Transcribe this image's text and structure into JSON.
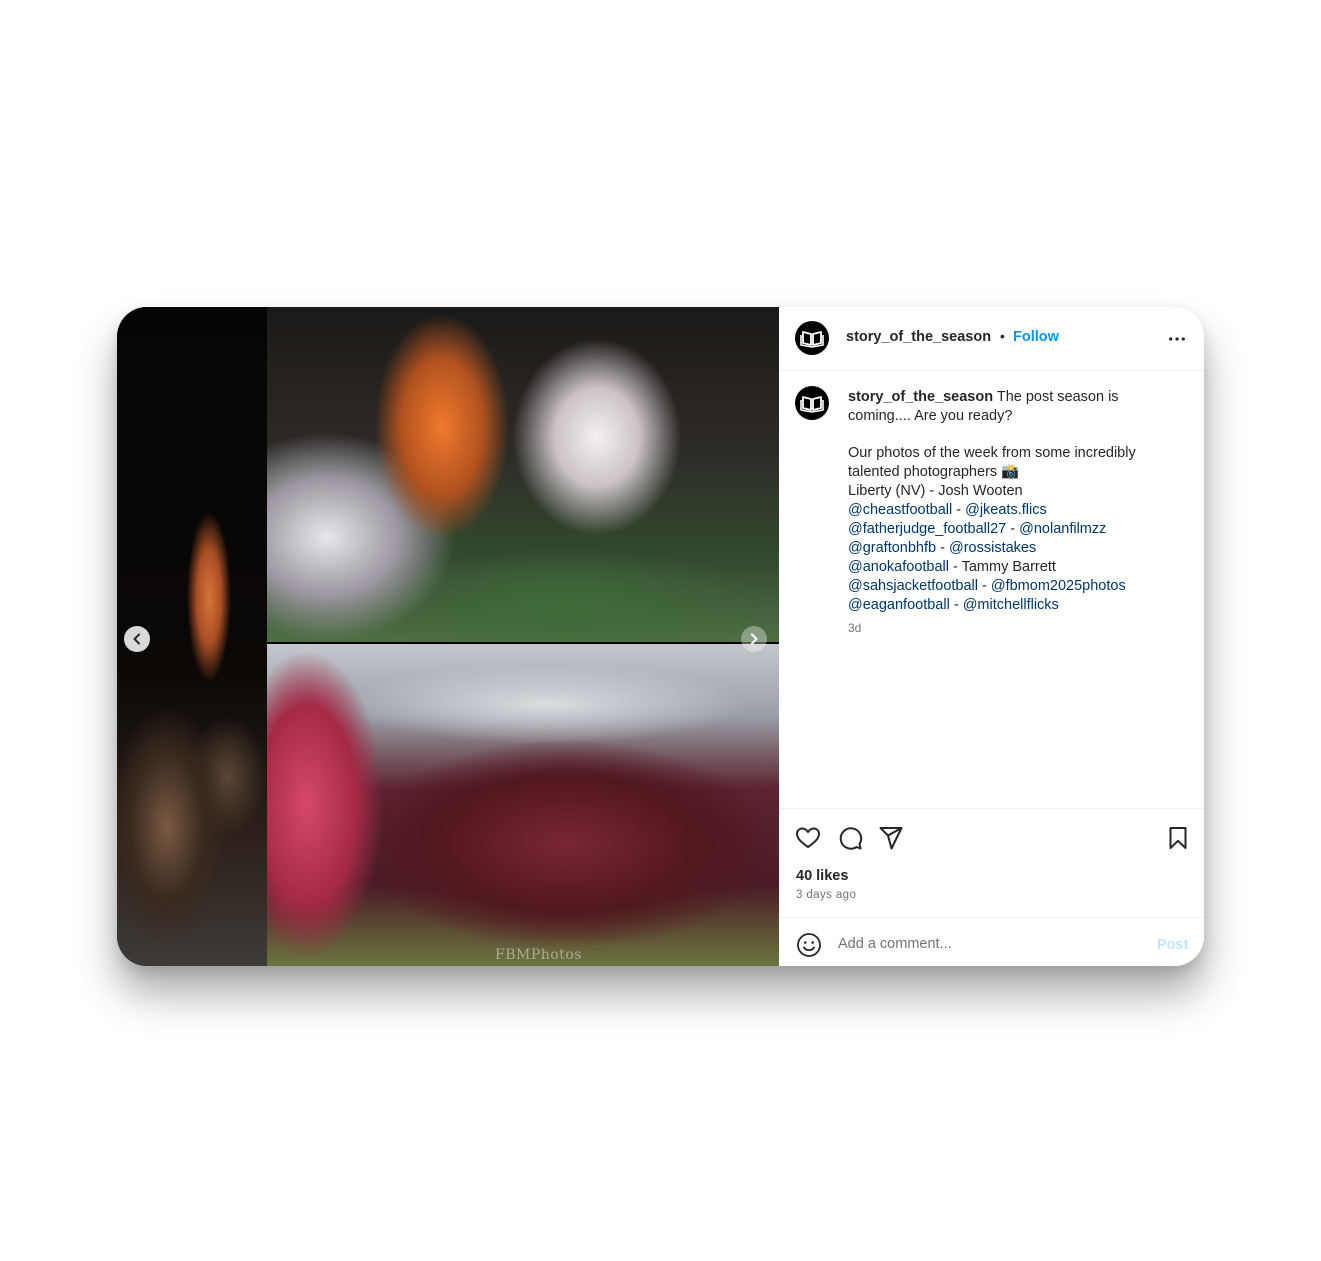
{
  "post": {
    "username": "story_of_the_season",
    "follow_label": "Follow",
    "separator": "•",
    "more_icon": "more-horizontal-icon",
    "avatar_icon": "open-book-logo",
    "caption": {
      "line1": "The post season is coming.... Are you ready?",
      "line2": "Our photos of the week from some incredibly talented photographers 📸",
      "line3": "Liberty (NV) - Josh Wooten",
      "credits": [
        {
          "a": "@cheastfootball",
          "sep": " - ",
          "b": "@jkeats.flics"
        },
        {
          "a": "@fatherjudge_football27",
          "sep": " - ",
          "b": "@nolanfilmzz"
        },
        {
          "a": "@graftonbhfb",
          "sep": " - ",
          "b": "@rossistakes"
        },
        {
          "a": "@anokafootball",
          "sep": " - ",
          "b": "Tammy Barrett"
        },
        {
          "a": "@sahsjacketfootball",
          "sep": " - ",
          "b": "@fbmom2025photos"
        },
        {
          "a": "@eaganfootball",
          "sep": " - ",
          "b": "@mitchellflicks"
        }
      ],
      "time": "3d"
    },
    "likes": "40 likes",
    "posted_ago": "3 days ago",
    "comment_placeholder": "Add a comment...",
    "post_label": "Post",
    "watermark": "FBMPhotos"
  },
  "colors": {
    "link_blue": "#0095f6",
    "mention_blue": "#00376b",
    "muted": "#737373",
    "post_disabled": "#c2e3fd"
  }
}
